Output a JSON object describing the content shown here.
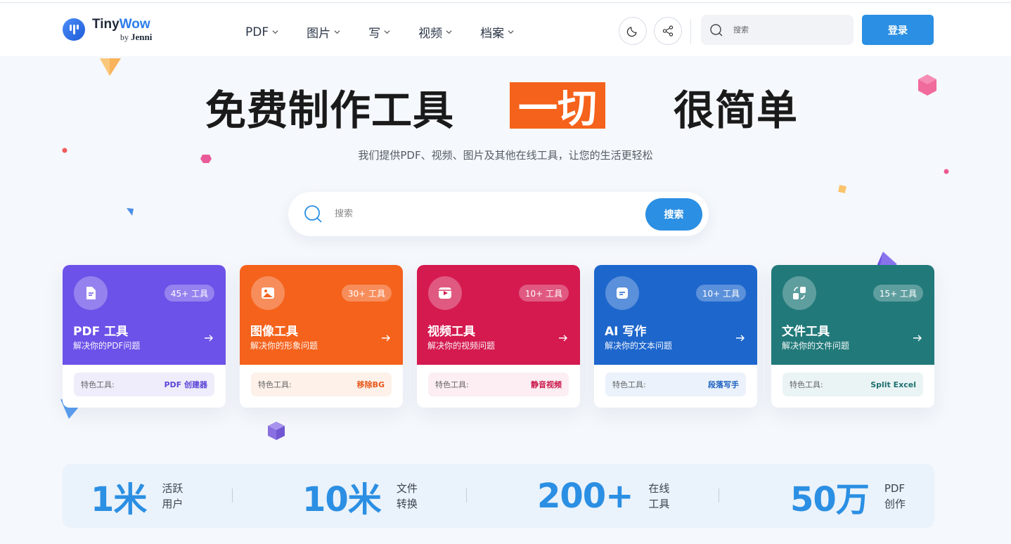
{
  "header": {
    "logo": {
      "name_part1": "Tiny",
      "name_part2": "Wow",
      "by": "by",
      "brand": "Jenni"
    },
    "nav": [
      {
        "label": "PDF"
      },
      {
        "label": "图片"
      },
      {
        "label": "写"
      },
      {
        "label": "视频"
      },
      {
        "label": "档案"
      }
    ],
    "search_placeholder": "搜索",
    "login_label": "登录"
  },
  "hero": {
    "title_part1": "免费制作工具",
    "title_highlight": "一切",
    "title_part3": "很简单",
    "subtitle": "我们提供PDF、视频、图片及其他在线工具，让您的生活更轻松",
    "search_placeholder": "搜索",
    "search_button": "搜索"
  },
  "cards": [
    {
      "title": "PDF 工具",
      "desc": "解决你的PDF问题",
      "count": "45+ 工具",
      "feature_label": "特色工具:",
      "feature_value": "PDF 创建器",
      "color": "#6c52e8",
      "feature_bg": "#efedfb",
      "feature_color": "#5b45d6",
      "icon": "pdf-file-icon"
    },
    {
      "title": "图像工具",
      "desc": "解决你的形象问题",
      "count": "30+ 工具",
      "feature_label": "特色工具:",
      "feature_value": "移除BG",
      "color": "#f4621c",
      "feature_bg": "#fdf1ea",
      "feature_color": "#e8581a",
      "icon": "image-icon"
    },
    {
      "title": "视频工具",
      "desc": "解决你的视频问题",
      "count": "10+ 工具",
      "feature_label": "特色工具:",
      "feature_value": "静音视频",
      "color": "#d41a4f",
      "feature_bg": "#fceef2",
      "feature_color": "#c9174a",
      "icon": "video-icon"
    },
    {
      "title": "AI 写作",
      "desc": "解决你的文本问题",
      "count": "10+ 工具",
      "feature_label": "特色工具:",
      "feature_value": "段落写手",
      "color": "#1d66cc",
      "feature_bg": "#ebf2fb",
      "feature_color": "#1b5fbf",
      "icon": "writing-icon"
    },
    {
      "title": "文件工具",
      "desc": "解决你的文件问题",
      "count": "15+ 工具",
      "feature_label": "特色工具:",
      "feature_value": "Split Excel",
      "color": "#22797a",
      "feature_bg": "#eaf4f4",
      "feature_color": "#1f6f70",
      "icon": "file-convert-icon"
    }
  ],
  "stats": [
    {
      "value": "1米",
      "label": "活跃用户"
    },
    {
      "value": "10米",
      "label": "文件转换"
    },
    {
      "value": "200+",
      "label": "在线工具"
    },
    {
      "value": "50万",
      "label": "PDF创作"
    }
  ]
}
